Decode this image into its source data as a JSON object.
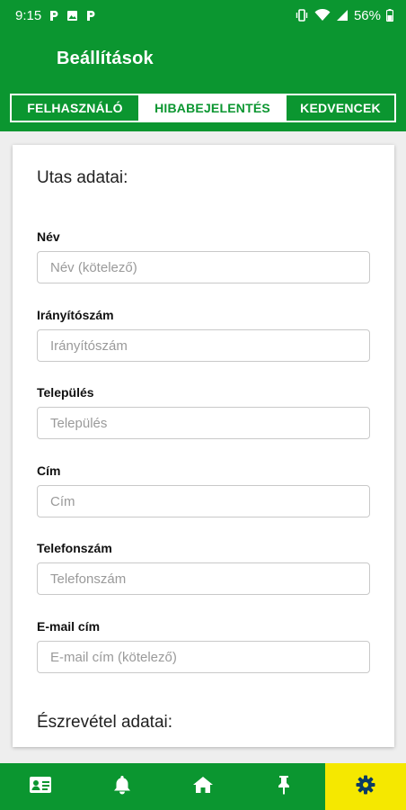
{
  "status": {
    "time": "9:15",
    "battery": "56%"
  },
  "appbar": {
    "title": "Beállítások"
  },
  "tabs": [
    {
      "label": "FELHASZNÁLÓ"
    },
    {
      "label": "HIBABEJELENTÉS"
    },
    {
      "label": "KEDVENCEK"
    }
  ],
  "form": {
    "section_passenger": "Utas adatai:",
    "fields": [
      {
        "label": "Név",
        "placeholder": "Név (kötelező)",
        "value": ""
      },
      {
        "label": "Irányítószám",
        "placeholder": "Irányítószám",
        "value": ""
      },
      {
        "label": "Település",
        "placeholder": "Település",
        "value": ""
      },
      {
        "label": "Cím",
        "placeholder": "Cím",
        "value": ""
      },
      {
        "label": "Telefonszám",
        "placeholder": "Telefonszám",
        "value": ""
      },
      {
        "label": "E-mail cím",
        "placeholder": "E-mail cím (kötelező)",
        "value": ""
      }
    ],
    "section_observation": "Észrevétel adatai:"
  },
  "bottom_nav": [
    {
      "icon": "id-card-icon",
      "active": false
    },
    {
      "icon": "bell-icon",
      "active": false
    },
    {
      "icon": "home-icon",
      "active": false
    },
    {
      "icon": "pin-icon",
      "active": false
    },
    {
      "icon": "gear-icon",
      "active": true
    }
  ],
  "colors": {
    "primary": "#0b9630",
    "active_nav": "#f5e800",
    "white": "#ffffff"
  }
}
